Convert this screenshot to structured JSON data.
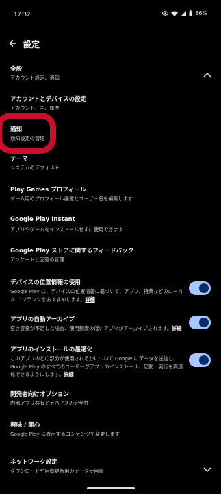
{
  "status": {
    "time": "17:32",
    "battery": "86%"
  },
  "header": {
    "title": "設定"
  },
  "general": {
    "label": "全般",
    "sub": "アカウント設定、通知"
  },
  "account": {
    "label": "アカウントとデバイスの設定",
    "sub": "アカウント、国、履歴"
  },
  "notify": {
    "label": "通知",
    "sub": "通知設定の管理"
  },
  "theme": {
    "label": "テーマ",
    "sub": "システムのデフォルト"
  },
  "games": {
    "label": "Play Games プロフィール",
    "sub": "ゲーム用のプロフィール画像とユーザー名を編集します"
  },
  "instant": {
    "label": "Google Play Instant",
    "sub": "アプリやゲームをインストールせずに使用できます"
  },
  "feedback": {
    "label": "Google Play ストアに関するフィードバック",
    "sub": "アンケートと回答の管理"
  },
  "location": {
    "label": "デバイスの位置情報の使用",
    "sub": "Google Play は、デバイスの位置情報に基づいて、アプリ、特典などのローカル コンテンツをおすすめします。",
    "more": "詳細",
    "enabled": true
  },
  "archive": {
    "label": "アプリの自動アーカイブ",
    "sub": "空き容量が不足した場合、使用頻度の低いアプリがアーカイブされます。",
    "more": "詳細",
    "enabled": true
  },
  "install": {
    "label": "アプリのインストールの最適化",
    "sub": "このアプリのどの部分が使用されるかについて Google にデータを送信し、Google Play のすべてのユーザーがアプリのインストール、起動、実行を高速化できるようにします。",
    "more": "詳細",
    "enabled": true
  },
  "developer": {
    "label": "開発者向けオプション",
    "sub": "内部アプリ共有とデバイスの完全性"
  },
  "interests": {
    "label": "興味 / 関心",
    "sub": "Google Play に表示するコンテンツを変更します"
  },
  "network": {
    "label": "ネットワーク設定",
    "sub": "ダウンロードや自動更新用のデータ使用量"
  },
  "colors": {
    "accent": "#a8c7fa",
    "highlight": "#c8102e",
    "background": "#000000"
  }
}
